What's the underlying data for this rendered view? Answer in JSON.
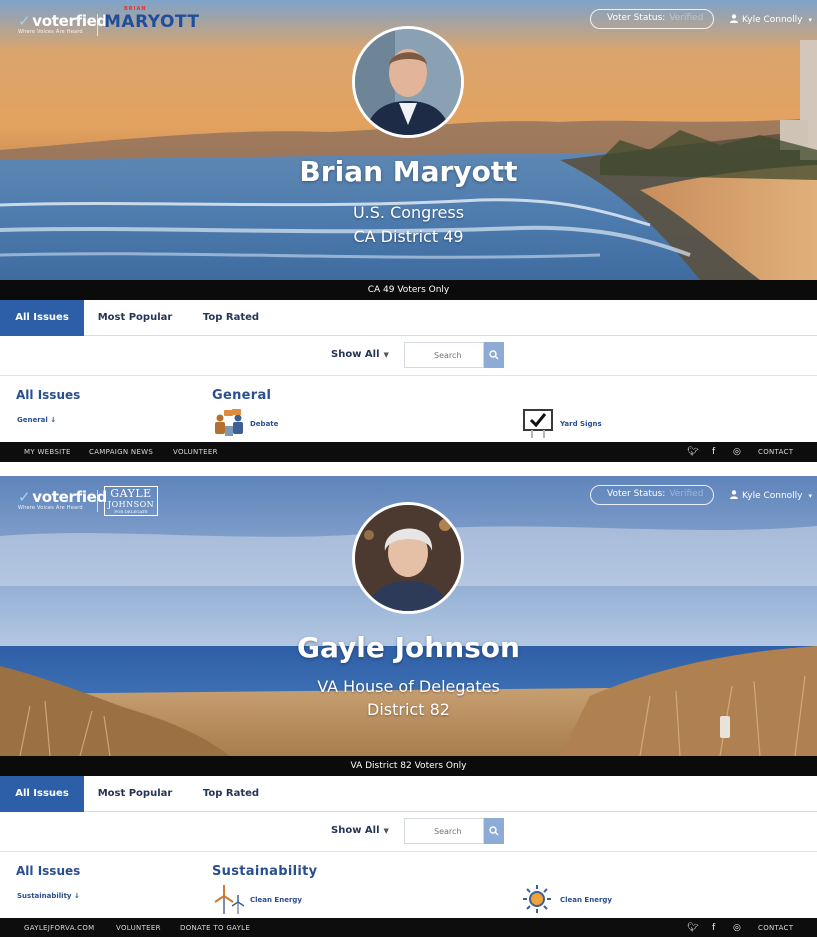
{
  "panels": [
    {
      "logo_text": "voterfied",
      "logo_tagline": "Where Voices Are Heard",
      "brand_small": "BRIAN",
      "brand_main": "MARYOTT",
      "voter_status_label": "Voter Status:",
      "voter_status_value": "Verified",
      "user_name": "Kyle Connolly",
      "candidate_name": "Brian Maryott",
      "office": "U.S. Congress",
      "district": "CA District 49",
      "voters_only": "CA 49 Voters Only",
      "tabs": [
        "All Issues",
        "Most Popular",
        "Top Rated"
      ],
      "show_all": "Show All",
      "search_placeholder": "Search",
      "sidebar_title": "All Issues",
      "sidebar_category": "General",
      "section_title": "General",
      "issues": [
        {
          "label": "Debate",
          "icon": "debate-icon"
        },
        {
          "label": "Yard Signs",
          "icon": "yard-sign-icon"
        }
      ],
      "footer_links": [
        "MY WEBSITE",
        "CAMPAIGN NEWS",
        "VOLUNTEER"
      ],
      "footer_contact": "CONTACT",
      "colors": {
        "accent": "#2d5fa8",
        "brand": "#1f4f9c"
      }
    },
    {
      "logo_text": "voterfied",
      "logo_tagline": "Where Voices Are Heard",
      "brand_line1": "GAYLE",
      "brand_line2": "JOHNSON",
      "brand_line3": "FOR DELEGATE",
      "voter_status_label": "Voter Status:",
      "voter_status_value": "Verified",
      "user_name": "Kyle Connolly",
      "candidate_name": "Gayle Johnson",
      "office": "VA House of Delegates",
      "district": "District 82",
      "voters_only": "VA District 82 Voters Only",
      "tabs": [
        "All Issues",
        "Most Popular",
        "Top Rated"
      ],
      "show_all": "Show All",
      "search_placeholder": "Search",
      "sidebar_title": "All Issues",
      "sidebar_category": "Sustainability",
      "section_title": "Sustainability",
      "issues": [
        {
          "label": "Clean Energy",
          "icon": "wind-turbine-icon"
        },
        {
          "label": "Clean Energy",
          "icon": "solar-sun-icon"
        }
      ],
      "footer_links": [
        "GAYLEJFORVA.COM",
        "VOLUNTEER",
        "DONATE TO GAYLE"
      ],
      "footer_contact": "CONTACT",
      "colors": {
        "accent": "#2d5fa8"
      }
    }
  ]
}
